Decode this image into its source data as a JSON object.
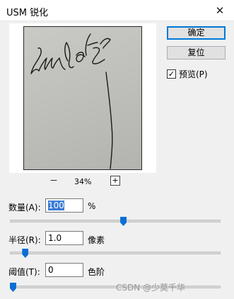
{
  "dialog": {
    "title": "USM 锐化",
    "close_glyph": "✕"
  },
  "preview": {
    "zoom_minus": "－",
    "zoom_level": "34%",
    "zoom_plus": "+"
  },
  "buttons": {
    "ok": "确定",
    "reset": "复位"
  },
  "preview_toggle": {
    "label": "预览(P)",
    "checked": true,
    "check_glyph": "✓"
  },
  "amount": {
    "label": "数量(A):",
    "value": "100",
    "unit": "%",
    "slider_fraction": 0.54
  },
  "radius": {
    "label": "半径(R):",
    "value": "1.0",
    "unit": "像素",
    "slider_fraction": 0.06
  },
  "threshold": {
    "label": "阈值(T):",
    "value": "0",
    "unit": "色阶",
    "slider_fraction": 0.0
  },
  "watermark": "CSDN @少莫千华",
  "colors": {
    "accent": "#0078d7",
    "slider_thumb": "#0a6fd6",
    "selection": "#3b7bd6"
  }
}
